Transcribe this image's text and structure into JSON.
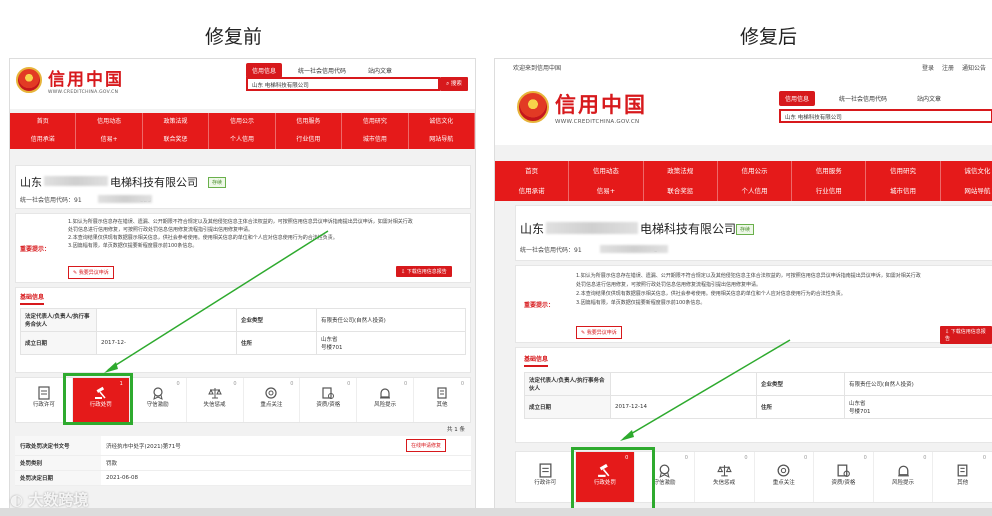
{
  "titles": {
    "before": "修复前",
    "after": "修复后"
  },
  "right_topbar": {
    "welcome": "欢迎来到信用中国",
    "links": [
      "登录",
      "注册",
      "通知公告"
    ]
  },
  "logo": {
    "name": "信用中国",
    "url": "WWW.CREDITCHINA.GOV.CN",
    "emblem_color": "#d7191c"
  },
  "search": {
    "tabs": [
      "信用信息",
      "统一社会信用代码",
      "站内文章"
    ],
    "value": "山东 电梯科技有限公司",
    "button": "搜索"
  },
  "nav": {
    "row1": [
      "首页",
      "信用动态",
      "政策法规",
      "信用公示",
      "信用服务",
      "信用研究",
      "诚信文化"
    ],
    "row2": [
      "信用承诺",
      "信易+",
      "联合奖惩",
      "个人信用",
      "行业信用",
      "城市信用",
      "网站导航"
    ]
  },
  "company": {
    "name_prefix": "山东",
    "name_suffix": "电梯科技有限公司",
    "status": "存续",
    "credit_code_label": "统一社会信用代码：",
    "credit_code_left": "91",
    "credit_code_left_tail": "828",
    "credit_code_right": "91",
    "credit_code_right_tail": "8"
  },
  "tips": {
    "label": "重要提示：",
    "line1a": "1.如认为所展示信息存在错误、遗漏、公开期限不符合规定以及其他侵犯信息主体合法权益的，可按照信用信息异议申诉指南提出异议申诉，如需对相关行政",
    "line1b": "处罚信息进行信用修复，可按照行政处罚信息信用修复流程指引提出信用修复申请。",
    "line2": "2.本查询结果仅供现有数据展示相关信息，供社会参考使用。使用相关信息的单位和个人应对信息使用行为的合法性负责。",
    "line3": "3.因篇幅有限，单页数据仅提要新程度展示前100条信息。",
    "appeal_button": "我要异议申诉",
    "download_button": "下载信用信息报告"
  },
  "basic": {
    "section_title": "基础信息",
    "legal_rep_label": "法定代表人/负责人/执行事务合伙人",
    "company_type_label": "企业类型",
    "company_type_value": "有限责任公司(自然人投资)",
    "setup_date_label": "成立日期",
    "setup_date_left": "2017-12-",
    "setup_date_right": "2017-12-14",
    "address_label": "住所",
    "address_left_1": "山东省",
    "address_left_2": "号楼701",
    "address_right_1": "山东省",
    "address_right_2": "号楼701"
  },
  "categories": {
    "items": [
      {
        "label": "行政许可",
        "icon": "license-icon",
        "count": ""
      },
      {
        "label": "行政处罚",
        "icon": "gavel-icon",
        "count": "1"
      },
      {
        "label": "守信激励",
        "icon": "reward-icon",
        "count": "0"
      },
      {
        "label": "失信惩戒",
        "icon": "scale-icon",
        "count": "0"
      },
      {
        "label": "重点关注",
        "icon": "target-icon",
        "count": "0"
      },
      {
        "label": "资质/资格",
        "icon": "cert-icon",
        "count": "0"
      },
      {
        "label": "风险提示",
        "icon": "alarm-icon",
        "count": "0"
      },
      {
        "label": "其他",
        "icon": "building-icon",
        "count": "0"
      }
    ],
    "right_count_active": "0",
    "highlight_color": "#2eaa2e"
  },
  "penalty": {
    "page_total": "共 1 条",
    "doc_no_label": "行政处罚决定书文号",
    "doc_no_value": "济经执市中处字(2021)第71号",
    "category_label": "处罚类别",
    "category_value": "罚款",
    "date_label": "处罚决定日期",
    "date_value": "2021-06-08",
    "repair_button": "在线申请修复"
  },
  "watermark": "大数跨境"
}
